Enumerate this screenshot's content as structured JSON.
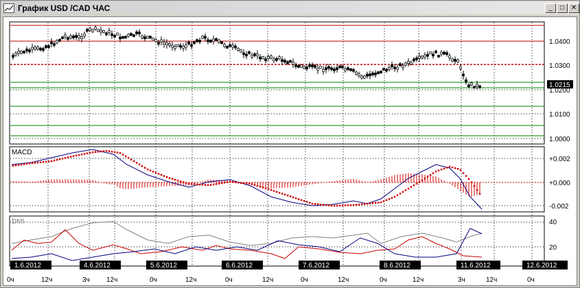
{
  "window": {
    "title": "График USD /CAD  ЧАС",
    "buttons": {
      "minimize": "_",
      "maximize": "□",
      "close": "✕"
    }
  },
  "main_chart": {
    "price_axis_labels": [
      "1.0400",
      "1.0300",
      "1.0200",
      "1.0100",
      "1.0000"
    ],
    "current_price": "1.0215"
  },
  "macd": {
    "label": "MACD",
    "axis_labels": [
      "+0.002",
      "+0.000",
      "-0.002"
    ]
  },
  "dmi": {
    "label": "DMI",
    "axis_labels": [
      "40",
      "20"
    ]
  },
  "time_axis": {
    "date_labels": [
      "1.6.2012",
      "4.6.2012",
      "5.6.2012",
      "6.6.2012",
      "7.6.2012",
      "8.6.2012",
      "11.6.2012",
      "12.6.2012"
    ],
    "hour_labels": [
      "0ч",
      "12ч",
      "3ч",
      "12ч",
      "0ч",
      "12ч",
      "0ч",
      "12ч",
      "0ч",
      "12ч",
      "0ч",
      "12ч",
      "3ч",
      "12ч",
      "0ч"
    ]
  }
}
